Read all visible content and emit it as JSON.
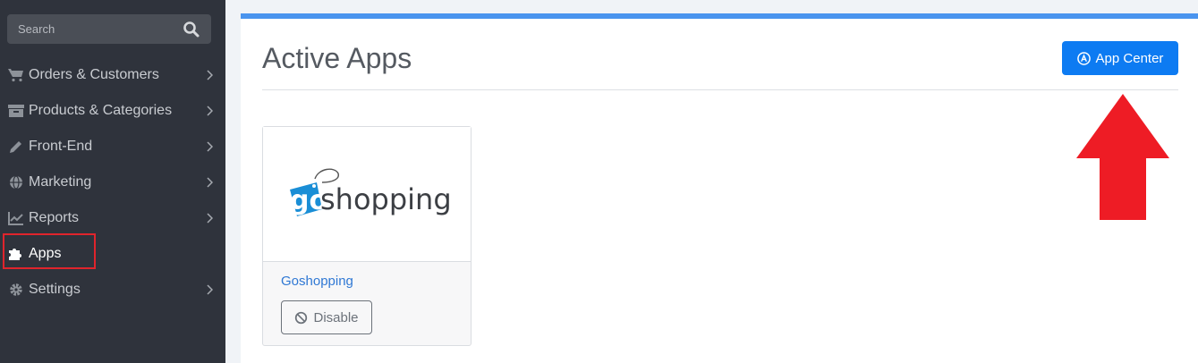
{
  "sidebar": {
    "search_placeholder": "Search",
    "items": [
      {
        "label": "Orders & Customers",
        "icon": "cart-icon"
      },
      {
        "label": "Products & Categories",
        "icon": "archive-icon"
      },
      {
        "label": "Front-End",
        "icon": "pencil-icon"
      },
      {
        "label": "Marketing",
        "icon": "globe-icon"
      },
      {
        "label": "Reports",
        "icon": "chart-line-icon"
      },
      {
        "label": "Apps",
        "icon": "puzzle-icon"
      },
      {
        "label": "Settings",
        "icon": "gear-icon"
      }
    ]
  },
  "main": {
    "title": "Active Apps",
    "app_center_label": "App Center",
    "apps": [
      {
        "name": "Goshopping",
        "logo_text_go": "go",
        "logo_text_rest": "shopping",
        "disable_label": "Disable"
      }
    ]
  },
  "colors": {
    "sidebar_bg": "#2f333c",
    "accent_blue": "#0d7bf2",
    "top_bar": "#4a94ee",
    "highlight_red": "#e0242c",
    "logo_blue": "#1a8ed6"
  }
}
